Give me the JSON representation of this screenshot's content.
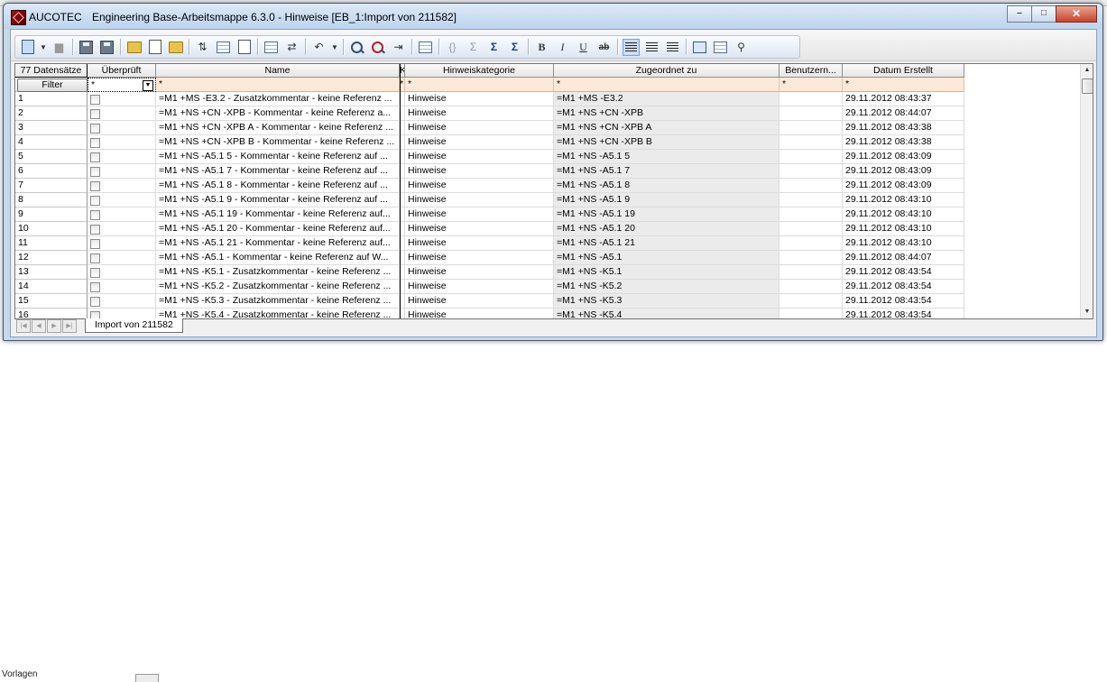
{
  "background": {
    "footer_text": "Vorlagen"
  },
  "window": {
    "app_name": "AUCOTEC",
    "title": "Engineering Base-Arbeitsmappe 6.3.0 - Hinweise [EB_1:Import von  211582]",
    "controls": {
      "minimize": "–",
      "maximize": "□",
      "close": "✕"
    }
  },
  "toolbar": {
    "icons": [
      "new-record-icon",
      "print-icon",
      "save-icon",
      "save-all-icon",
      "open-folder-icon",
      "folder-export-icon",
      "folder-import-icon",
      "sort-icon",
      "refresh-icon",
      "properties-icon",
      "grid-view-icon",
      "link-icon",
      "undo-icon",
      "find-icon",
      "find-replace-icon",
      "goto-icon",
      "settings-icon",
      "brace-icon",
      "sum-a-icon",
      "sum-t-icon",
      "sum-s-icon",
      "bold-icon",
      "italic-icon",
      "underline-icon",
      "strikethrough-icon",
      "align-left-icon",
      "align-center-icon",
      "align-right-icon",
      "tree-view-icon",
      "form-view-icon",
      "hierarchy-icon"
    ],
    "format": {
      "bold": "B",
      "italic": "I",
      "underline": "U",
      "strike": "ab",
      "sum_a": "Σ",
      "sum_t": "Σ",
      "sum_s": "Σ",
      "brace": "{}"
    }
  },
  "grid": {
    "record_count": "77 Datensätze",
    "filter_button": "Filter",
    "columns": {
      "checked": "Überprüft",
      "name": "Name",
      "k": "K",
      "category": "Hinweiskategorie",
      "assigned": "Zugeordnet zu",
      "user": "Benutzern...",
      "created": "Datum Erstellt"
    },
    "filters": {
      "name": "*",
      "k": "*",
      "category": "*",
      "assigned": "*",
      "user": "*",
      "created": "*",
      "checked": "*"
    },
    "rows": [
      {
        "no": "1",
        "name": "=M1 +MS -E3.2 - Zusatzkommentar - keine Referenz ...",
        "category": "Hinweise",
        "assigned": "=M1 +MS -E3.2",
        "user": "",
        "created": "29.11.2012  08:43:37"
      },
      {
        "no": "2",
        "name": "=M1 +NS +CN -XPB - Kommentar - keine Referenz a...",
        "category": "Hinweise",
        "assigned": "=M1 +NS +CN -XPB",
        "user": "",
        "created": "29.11.2012  08:44:07"
      },
      {
        "no": "3",
        "name": "=M1 +NS +CN -XPB A - Kommentar - keine Referenz ...",
        "category": "Hinweise",
        "assigned": "=M1 +NS +CN -XPB A",
        "user": "",
        "created": "29.11.2012  08:43:38"
      },
      {
        "no": "4",
        "name": "=M1 +NS +CN -XPB B - Kommentar - keine Referenz ...",
        "category": "Hinweise",
        "assigned": "=M1 +NS +CN -XPB B",
        "user": "",
        "created": "29.11.2012  08:43:38"
      },
      {
        "no": "5",
        "name": "=M1 +NS -A5.1 5 - Kommentar - keine Referenz auf ...",
        "category": "Hinweise",
        "assigned": "=M1 +NS -A5.1 5",
        "user": "",
        "created": "29.11.2012  08:43:09"
      },
      {
        "no": "6",
        "name": "=M1 +NS -A5.1 7 - Kommentar - keine Referenz auf ...",
        "category": "Hinweise",
        "assigned": "=M1 +NS -A5.1 7",
        "user": "",
        "created": "29.11.2012  08:43:09"
      },
      {
        "no": "7",
        "name": "=M1 +NS -A5.1 8 - Kommentar - keine Referenz auf ...",
        "category": "Hinweise",
        "assigned": "=M1 +NS -A5.1 8",
        "user": "",
        "created": "29.11.2012  08:43:09"
      },
      {
        "no": "8",
        "name": "=M1 +NS -A5.1 9 - Kommentar - keine Referenz auf ...",
        "category": "Hinweise",
        "assigned": "=M1 +NS -A5.1 9",
        "user": "",
        "created": "29.11.2012  08:43:10"
      },
      {
        "no": "9",
        "name": "=M1 +NS -A5.1 19 - Kommentar - keine Referenz auf...",
        "category": "Hinweise",
        "assigned": "=M1 +NS -A5.1 19",
        "user": "",
        "created": "29.11.2012  08:43:10"
      },
      {
        "no": "10",
        "name": "=M1 +NS -A5.1 20 - Kommentar - keine Referenz auf...",
        "category": "Hinweise",
        "assigned": "=M1 +NS -A5.1 20",
        "user": "",
        "created": "29.11.2012  08:43:10"
      },
      {
        "no": "11",
        "name": "=M1 +NS -A5.1 21 - Kommentar - keine Referenz auf...",
        "category": "Hinweise",
        "assigned": "=M1 +NS -A5.1 21",
        "user": "",
        "created": "29.11.2012  08:43:10"
      },
      {
        "no": "12",
        "name": "=M1 +NS -A5.1 - Kommentar - keine Referenz auf W...",
        "category": "Hinweise",
        "assigned": "=M1 +NS -A5.1",
        "user": "",
        "created": "29.11.2012  08:44:07"
      },
      {
        "no": "13",
        "name": "=M1 +NS -K5.1 - Zusatzkommentar - keine Referenz ...",
        "category": "Hinweise",
        "assigned": "=M1 +NS -K5.1",
        "user": "",
        "created": "29.11.2012  08:43:54"
      },
      {
        "no": "14",
        "name": "=M1 +NS -K5.2 - Zusatzkommentar - keine Referenz ...",
        "category": "Hinweise",
        "assigned": "=M1 +NS -K5.2",
        "user": "",
        "created": "29.11.2012  08:43:54"
      },
      {
        "no": "15",
        "name": "=M1 +NS -K5.3 - Zusatzkommentar - keine Referenz ...",
        "category": "Hinweise",
        "assigned": "=M1 +NS -K5.3",
        "user": "",
        "created": "29.11.2012  08:43:54"
      },
      {
        "no": "16",
        "name": "=M1 +NS -K5.4 - Zusatzkommentar - keine Referenz ...",
        "category": "Hinweise",
        "assigned": "=M1 +NS -K5.4",
        "user": "",
        "created": "29.11.2012  08:43:54"
      }
    ]
  },
  "tabs": {
    "sheet_tab": "Import von  211582"
  },
  "colors": {
    "filter_row": "#fde9d7",
    "window_frame": "#c4d8ee",
    "accent": "#2f5c92"
  }
}
